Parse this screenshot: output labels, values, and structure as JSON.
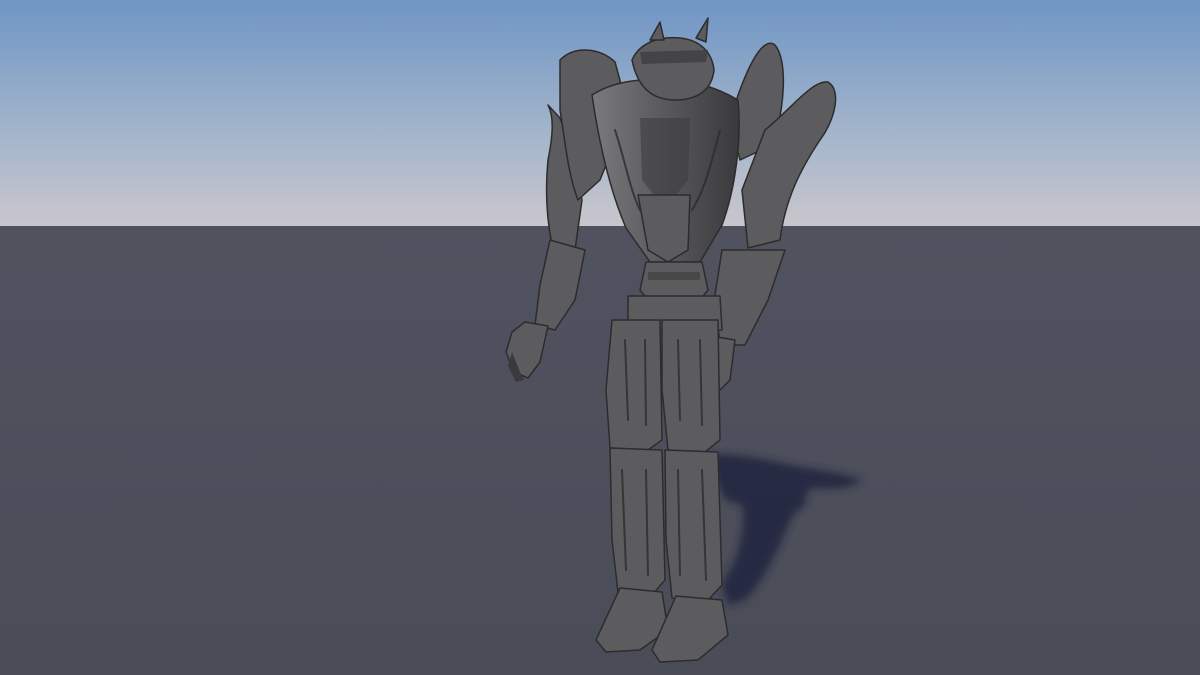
{
  "scene": {
    "subject": "robot-model",
    "render_style": "untextured-clay",
    "colors": {
      "sky_top": "#6f95c4",
      "sky_mid": "#a9b8cc",
      "horizon": "#c9c6cc",
      "ground": "#4a4c58",
      "ground_far": "#50525f",
      "model_base": "#5c5c5e",
      "model_light": "#7a7a7c",
      "model_dark": "#3a3a3c",
      "model_edge": "#2c2c2e",
      "shadow": "#23283f"
    }
  }
}
